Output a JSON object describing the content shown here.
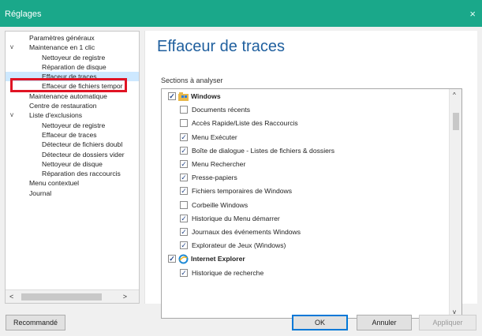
{
  "window": {
    "title": "Réglages",
    "close_glyph": "×"
  },
  "tree": {
    "items": [
      {
        "label": "Paramètres généraux",
        "level": 0,
        "expander": ""
      },
      {
        "label": "Maintenance en 1 clic",
        "level": 0,
        "expander": "v"
      },
      {
        "label": "Nettoyeur de registre",
        "level": 1,
        "expander": ""
      },
      {
        "label": "Réparation de disque",
        "level": 1,
        "expander": ""
      },
      {
        "label": "Effaceur de traces",
        "level": 1,
        "expander": "",
        "selected": true
      },
      {
        "label": "Effaceur de fichiers tempor",
        "level": 1,
        "expander": ""
      },
      {
        "label": "Maintenance automatique",
        "level": 0,
        "expander": ""
      },
      {
        "label": "Centre de restauration",
        "level": 0,
        "expander": ""
      },
      {
        "label": "Liste d'exclusions",
        "level": 0,
        "expander": "v"
      },
      {
        "label": "Nettoyeur de registre",
        "level": 1,
        "expander": ""
      },
      {
        "label": "Effaceur de traces",
        "level": 1,
        "expander": ""
      },
      {
        "label": "Détecteur de fichiers doubl",
        "level": 1,
        "expander": ""
      },
      {
        "label": "Détecteur de dossiers vider",
        "level": 1,
        "expander": ""
      },
      {
        "label": "Nettoyeur de disque",
        "level": 1,
        "expander": ""
      },
      {
        "label": "Réparation des raccourcis",
        "level": 1,
        "expander": ""
      },
      {
        "label": "Menu contextuel",
        "level": 0,
        "expander": ""
      },
      {
        "label": "Journal",
        "level": 0,
        "expander": ""
      }
    ],
    "scroll_left": "<",
    "scroll_right": ">"
  },
  "panel": {
    "heading": "Effaceur de traces",
    "section_label": "Sections à analyser",
    "items": [
      {
        "label": "Windows",
        "group": true,
        "checked": true,
        "icon": "windows-folder-icon"
      },
      {
        "label": "Documents récents",
        "checked": false
      },
      {
        "label": "Accès Rapide/Liste des Raccourcis",
        "checked": false
      },
      {
        "label": "Menu Exécuter",
        "checked": true
      },
      {
        "label": "Boîte de dialogue - Listes de fichiers & dossiers",
        "checked": true
      },
      {
        "label": "Menu Rechercher",
        "checked": true
      },
      {
        "label": "Presse-papiers",
        "checked": true
      },
      {
        "label": "Fichiers temporaires de Windows",
        "checked": true
      },
      {
        "label": "Corbeille Windows",
        "checked": false
      },
      {
        "label": "Historique du Menu démarrer",
        "checked": true
      },
      {
        "label": "Journaux des événements Windows",
        "checked": true
      },
      {
        "label": "Explorateur de Jeux (Windows)",
        "checked": true
      },
      {
        "label": "Internet Explorer",
        "group": true,
        "checked": true,
        "icon": "internet-explorer-icon"
      },
      {
        "label": "Historique de recherche",
        "checked": true
      }
    ],
    "scroll_up": "^",
    "scroll_down": "v"
  },
  "buttons": {
    "recommended": "Recommandé",
    "ok": "OK",
    "cancel": "Annuler",
    "apply": "Appliquer"
  }
}
